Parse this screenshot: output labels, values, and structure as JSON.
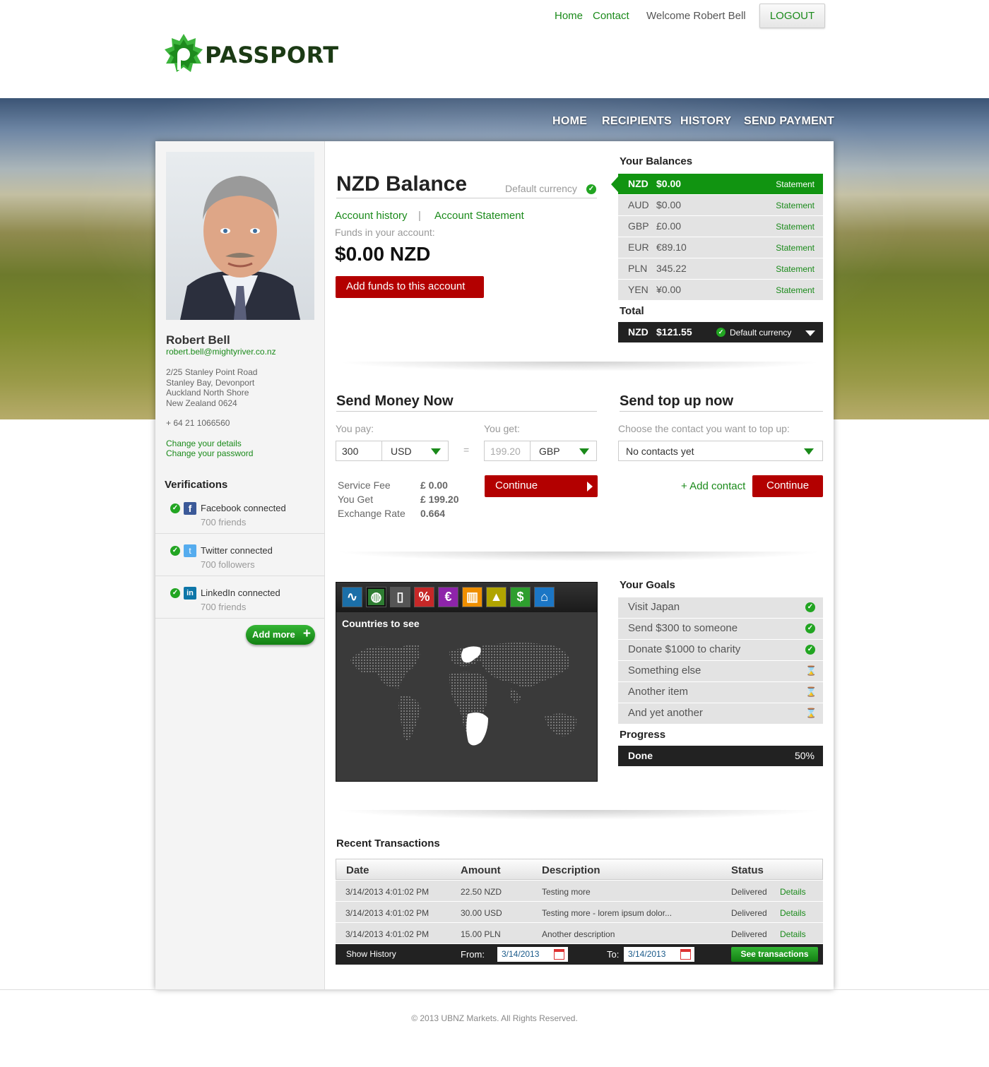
{
  "header": {
    "logo_text": "PASSPORT",
    "nav": [
      "Home",
      "Contact"
    ],
    "welcome": "Welcome Robert Bell",
    "logout": "LOGOUT"
  },
  "main_nav": [
    "HOME",
    "RECIPIENTS",
    "HISTORY",
    "SEND PAYMENT"
  ],
  "profile": {
    "name": "Robert Bell",
    "email": "robert.bell@mightyriver.co.nz",
    "address": [
      "2/25 Stanley Point Road",
      "Stanley Bay, Devonport",
      "Auckland North Shore",
      "New Zealand 0624"
    ],
    "phone": "+ 64 21 1066560",
    "change_details": "Change your details",
    "change_password": "Change your password"
  },
  "verifications": {
    "title": "Verifications",
    "items": [
      {
        "label": "Facebook connected",
        "sub": "700 friends",
        "icon": "facebook-icon",
        "color": "#3b5998"
      },
      {
        "label": "Twitter connected",
        "sub": "700 followers",
        "icon": "twitter-icon",
        "color": "#55acee"
      },
      {
        "label": "LinkedIn connected",
        "sub": "700 friends",
        "icon": "linkedin-icon",
        "color": "#0e76a8"
      }
    ],
    "add_more": "Add more"
  },
  "balance": {
    "title": "NZD Balance",
    "default_label": "Default currency",
    "account_history": "Account history",
    "divider": "|",
    "account_statement": "Account Statement",
    "funds_label": "Funds in your account:",
    "amount": "$0.00 NZD",
    "add_funds": "Add funds to this account"
  },
  "your_balances": {
    "title": "Your Balances",
    "rows": [
      {
        "code": "NZD",
        "value": "$0.00",
        "link": "Statement"
      },
      {
        "code": "AUD",
        "value": "$0.00",
        "link": "Statement"
      },
      {
        "code": "GBP",
        "value": "£0.00",
        "link": "Statement"
      },
      {
        "code": "EUR",
        "value": "€89.10",
        "link": "Statement"
      },
      {
        "code": "PLN",
        "value": "345.22",
        "link": "Statement"
      },
      {
        "code": "YEN",
        "value": "¥0.00",
        "link": "Statement"
      }
    ],
    "total_label": "Total",
    "total_code": "NZD",
    "total_value": "$121.55",
    "total_default": "Default currency"
  },
  "send_money": {
    "title": "Send Money Now",
    "you_pay": "You pay:",
    "you_get": "You get:",
    "pay_amount": "300",
    "pay_currency": "USD",
    "equals": "=",
    "get_amount": "199.20",
    "get_currency": "GBP",
    "fee_label": "Service Fee",
    "fee_value": "£ 0.00",
    "get_label": "You Get",
    "get_value": "£ 199.20",
    "rate_label": "Exchange Rate",
    "rate_value": "0.664",
    "continue": "Continue"
  },
  "top_up": {
    "title": "Send top up now",
    "label": "Choose the contact you want to top up:",
    "select": "No contacts yet",
    "add_contact": "+ Add contact",
    "continue": "Continue"
  },
  "map_widget": {
    "title": "Countries to see",
    "tools": [
      {
        "icon": "activity-icon",
        "glyph": "∿",
        "color": "#1b6fa8"
      },
      {
        "icon": "globe-icon",
        "glyph": "◍",
        "color": "#2e7d32"
      },
      {
        "icon": "document-icon",
        "glyph": "▯",
        "color": "#555555"
      },
      {
        "icon": "percent-icon",
        "glyph": "%",
        "color": "#c62828"
      },
      {
        "icon": "euro-icon",
        "glyph": "€",
        "color": "#8e24aa"
      },
      {
        "icon": "bar-chart-icon",
        "glyph": "▥",
        "color": "#ef8f00"
      },
      {
        "icon": "gold-icon",
        "glyph": "▲",
        "color": "#b0a400"
      },
      {
        "icon": "dollar-icon",
        "glyph": "$",
        "color": "#2e9e2e"
      },
      {
        "icon": "bank-icon",
        "glyph": "⌂",
        "color": "#1b76c5"
      }
    ]
  },
  "goals": {
    "title": "Your Goals",
    "items": [
      {
        "label": "Visit Japan",
        "done": true
      },
      {
        "label": "Send $300 to someone",
        "done": true
      },
      {
        "label": "Donate $1000 to charity",
        "done": true
      },
      {
        "label": "Something else",
        "done": false
      },
      {
        "label": "Another item",
        "done": false
      },
      {
        "label": "And yet another",
        "done": false
      }
    ],
    "progress_title": "Progress",
    "progress_label": "Done",
    "progress_value": "50%",
    "progress_fraction": 0.5
  },
  "transactions": {
    "title": "Recent Transactions",
    "columns": [
      "Date",
      "Amount",
      "Description",
      "Status"
    ],
    "rows": [
      {
        "date": "3/14/2013 4:01:02 PM",
        "amount": "22.50 NZD",
        "description": "Testing more",
        "status": "Delivered",
        "link": "Details"
      },
      {
        "date": "3/14/2013 4:01:02 PM",
        "amount": "30.00 USD",
        "description": "Testing more - lorem ipsum dolor...",
        "status": "Delivered",
        "link": "Details"
      },
      {
        "date": "3/14/2013 4:01:02 PM",
        "amount": "15.00 PLN",
        "description": "Another description",
        "status": "Delivered",
        "link": "Details"
      }
    ],
    "show_history": "Show History",
    "from_label": "From:",
    "from_value": "3/14/2013",
    "to_label": "To:",
    "to_value": "3/14/2013",
    "see_transactions": "See transactions"
  },
  "footer": "© 2013 UBNZ Markets. All Rights Reserved.",
  "colors": {
    "brand_green": "#1a8a1a",
    "accent_red": "#b30000",
    "dark": "#222222"
  }
}
